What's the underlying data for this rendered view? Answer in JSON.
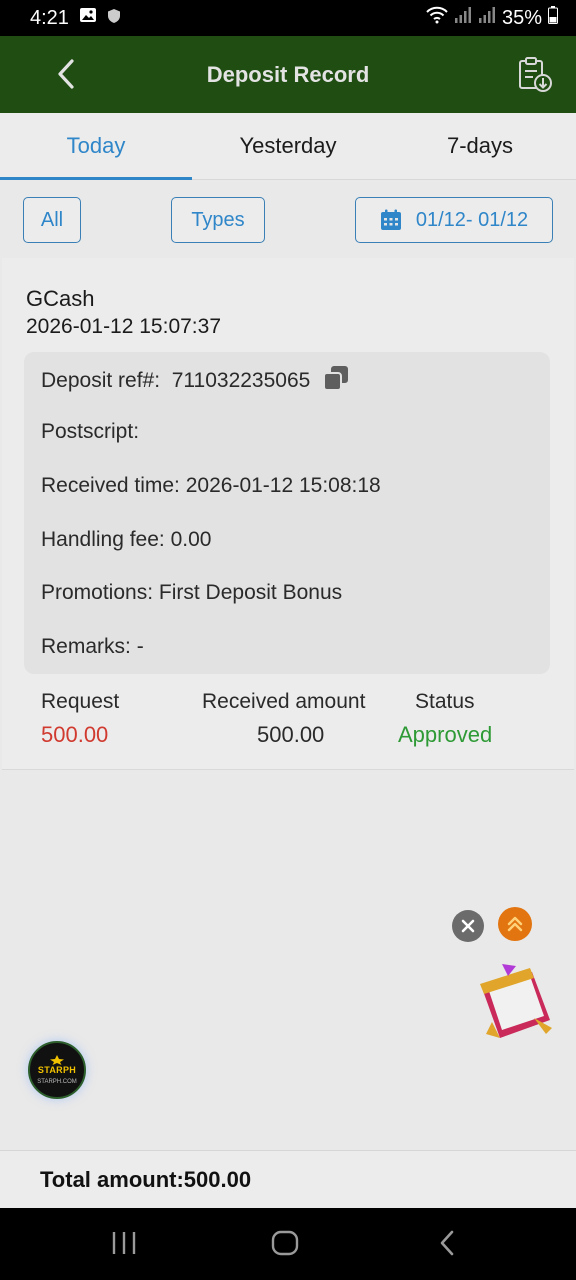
{
  "status_bar": {
    "time": "4:21",
    "battery": "35%"
  },
  "header": {
    "title": "Deposit Record"
  },
  "tabs": [
    {
      "label": "Today",
      "active": true
    },
    {
      "label": "Yesterday",
      "active": false
    },
    {
      "label": "7-days",
      "active": false
    }
  ],
  "filters": {
    "all_label": "All",
    "types_label": "Types",
    "date_range": "01/12- 01/12"
  },
  "record": {
    "method": "GCash",
    "created_time": "2026-01-12 15:07:37",
    "details": {
      "ref_label": "Deposit ref#:",
      "ref_value": "711032235065",
      "postscript_label": "Postscript:",
      "postscript_value": "",
      "received_time_label": "Received time:",
      "received_time_value": "2026-01-12 15:08:18",
      "fee_label": "Handling fee:",
      "fee_value": "0.00",
      "promotions_label": "Promotions:",
      "promotions_value": "First Deposit Bonus",
      "remarks_label": "Remarks:",
      "remarks_value": "-"
    },
    "summary": {
      "request_label": "Request",
      "request_value": "500.00",
      "received_label": "Received amount",
      "received_value": "500.00",
      "status_label": "Status",
      "status_value": "Approved"
    }
  },
  "floating": {
    "logo_brand": "STARPH",
    "logo_url": "STARPH.COM"
  },
  "footer": {
    "total_label": "Total amount:",
    "total_value": "500.00"
  },
  "colors": {
    "header_bg": "#1f4d12",
    "accent": "#2f86c9",
    "request": "#d03a2f",
    "approved": "#2e9a35"
  }
}
